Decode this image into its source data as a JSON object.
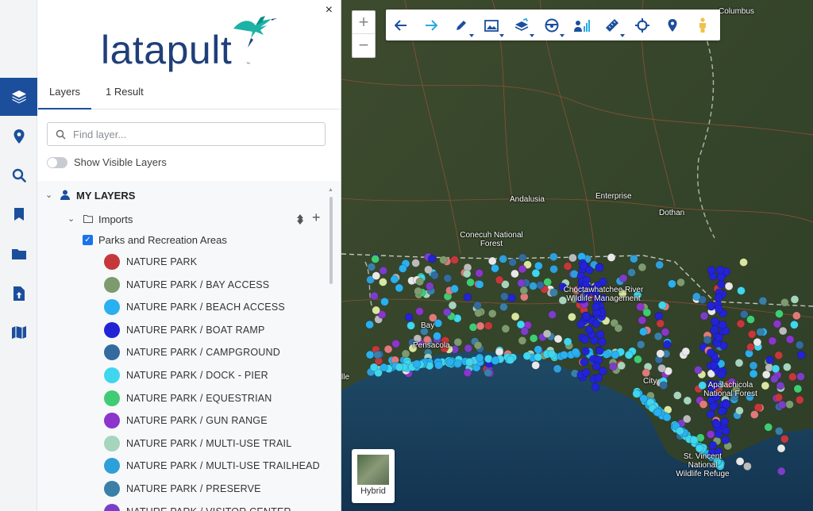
{
  "nav_rail": {
    "items": [
      {
        "name": "layers",
        "icon": "layers-icon"
      },
      {
        "name": "location",
        "icon": "map-pin-icon"
      },
      {
        "name": "search",
        "icon": "search-icon"
      },
      {
        "name": "bookmarks",
        "icon": "bookmark-icon"
      },
      {
        "name": "folder",
        "icon": "folder-icon"
      },
      {
        "name": "upload",
        "icon": "upload-file-icon"
      },
      {
        "name": "map",
        "icon": "map-icon"
      }
    ],
    "active_color": "#1b4f9c"
  },
  "panel": {
    "close_label": "×",
    "logo_text": "latapult",
    "logo_tm": "™",
    "tabs": [
      {
        "label": "Layers",
        "active": true
      },
      {
        "label": "1 Result",
        "active": false
      }
    ],
    "search": {
      "placeholder": "Find layer...",
      "value": ""
    },
    "toggle": {
      "label": "Show Visible Layers",
      "on": false
    },
    "tree": {
      "my_layers": "MY LAYERS",
      "imports": "Imports",
      "layer_name": "Parks and Recreation Areas",
      "legend": [
        {
          "label": "NATURE PARK",
          "color": "#c4383b"
        },
        {
          "label": "NATURE PARK / BAY ACCESS",
          "color": "#7d9b6e"
        },
        {
          "label": "NATURE PARK / BEACH ACCESS",
          "color": "#29b0f0"
        },
        {
          "label": "NATURE PARK / BOAT RAMP",
          "color": "#2323d6"
        },
        {
          "label": "NATURE PARK / CAMPGROUND",
          "color": "#336b9e"
        },
        {
          "label": "NATURE PARK / DOCK - PIER",
          "color": "#3fd6ee"
        },
        {
          "label": "NATURE PARK / EQUESTRIAN",
          "color": "#3fcc73"
        },
        {
          "label": "NATURE PARK / GUN RANGE",
          "color": "#8b35cc"
        },
        {
          "label": "NATURE PARK / MULTI-USE TRAIL",
          "color": "#a6d4bd"
        },
        {
          "label": "NATURE PARK / MULTI-USE TRAILHEAD",
          "color": "#2f9fd9"
        },
        {
          "label": "NATURE PARK / PRESERVE",
          "color": "#3a7fa8"
        },
        {
          "label": "NATURE PARK / VISITOR CENTER",
          "color": "#7a3ec9"
        }
      ]
    }
  },
  "map": {
    "zoom_in": "+",
    "zoom_out": "−",
    "toolbar": [
      {
        "name": "back",
        "icon": "arrow-left-icon",
        "dropdown": false
      },
      {
        "name": "forward",
        "icon": "arrow-right-icon",
        "dropdown": false
      },
      {
        "name": "draw",
        "icon": "pencil-icon",
        "dropdown": true
      },
      {
        "name": "image",
        "icon": "image-icon",
        "dropdown": true
      },
      {
        "name": "layers-tool",
        "icon": "layers-edit-icon",
        "dropdown": true
      },
      {
        "name": "drive",
        "icon": "steering-wheel-icon",
        "dropdown": true
      },
      {
        "name": "demographics",
        "icon": "person-chart-icon",
        "dropdown": false
      },
      {
        "name": "measure",
        "icon": "ruler-icon",
        "dropdown": true
      },
      {
        "name": "locate",
        "icon": "crosshair-icon",
        "dropdown": false
      },
      {
        "name": "place-pin",
        "icon": "map-pin-icon",
        "dropdown": false
      },
      {
        "name": "street-view",
        "icon": "pegman-icon",
        "dropdown": false
      }
    ],
    "basemap_label": "Hybrid",
    "place_labels": [
      "Columbus",
      "Andalusia",
      "Enterprise",
      "Dothan",
      "Conecuh National Forest",
      "Choctawhatchee River Wildlife Management",
      "City",
      "Apalachicola National Forest",
      "St. Vincent National Wildlife Refuge",
      "Pensacola",
      "Bay",
      "lle"
    ]
  }
}
